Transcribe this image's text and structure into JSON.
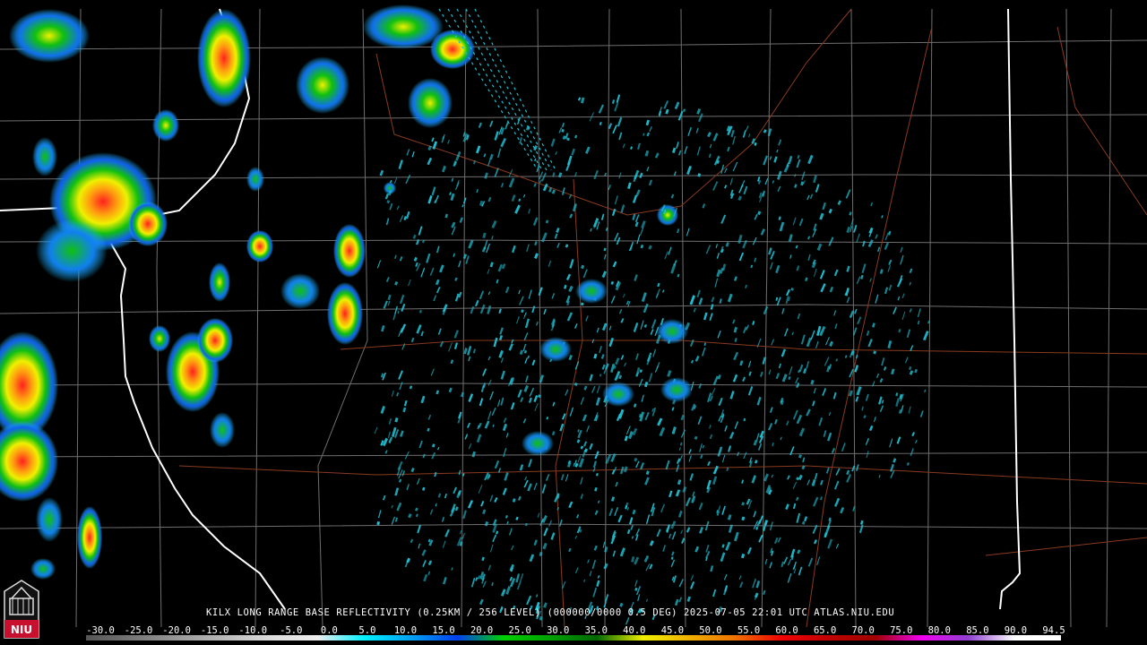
{
  "caption": "KILX LONG RANGE BASE REFLECTIVITY (0.25KM / 256 LEVEL) (000000/0000 0.5 DEG) 2025-07-05 22:01 UTC  ATLAS.NIU.EDU",
  "logo_text": "NIU",
  "colorbar": {
    "ticks": [
      "-30.0",
      "-25.0",
      "-20.0",
      "-15.0",
      "-10.0",
      "-5.0",
      "0.0",
      "5.0",
      "10.0",
      "15.0",
      "20.0",
      "25.0",
      "30.0",
      "35.0",
      "40.0",
      "45.0",
      "50.0",
      "55.0",
      "60.0",
      "65.0",
      "70.0",
      "75.0",
      "80.0",
      "85.0",
      "90.0",
      "94.5"
    ],
    "stops": [
      "#555555",
      "#777777",
      "#999999",
      "#bbbbbb",
      "#dddddd",
      "#eeeeee",
      "#00f0ff",
      "#00a0f0",
      "#0040f0",
      "#00d000",
      "#00a000",
      "#006800",
      "#f0f000",
      "#f0b000",
      "#f07000",
      "#f00000",
      "#c00000",
      "#a00000",
      "#f000f0",
      "#9040d0",
      "#ffffff",
      "#ffffff"
    ]
  },
  "colors": {
    "state_border": "#ffffff",
    "county_line": "#6f6f6f",
    "highway": "#8a3a1e",
    "clutter": "#1fbfd2"
  }
}
